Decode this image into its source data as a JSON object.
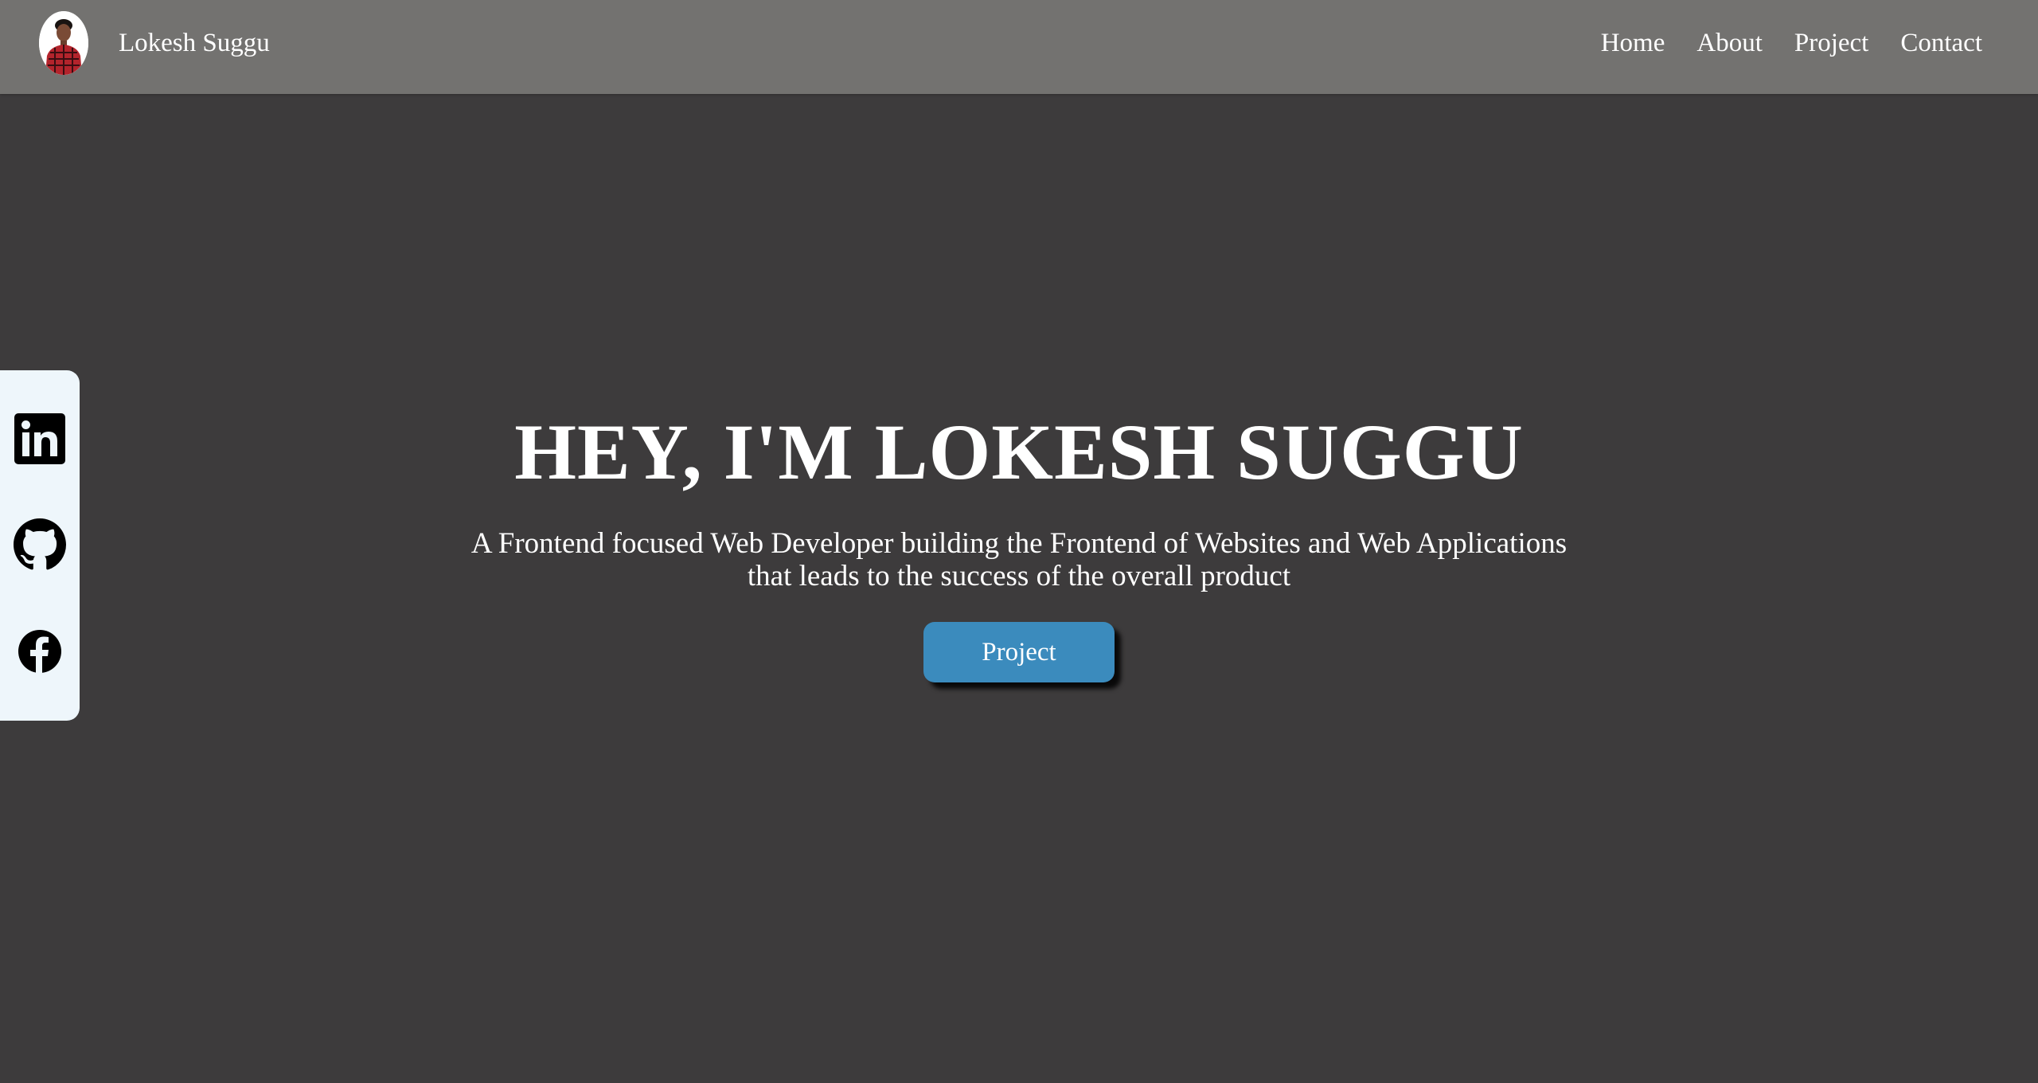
{
  "header": {
    "brand_name": "Lokesh Suggu",
    "avatar_icon": "profile-photo",
    "nav": [
      {
        "label": "Home"
      },
      {
        "label": "About"
      },
      {
        "label": "Project"
      },
      {
        "label": "Contact"
      }
    ]
  },
  "social": [
    {
      "icon": "linkedin-icon"
    },
    {
      "icon": "github-icon"
    },
    {
      "icon": "facebook-icon"
    }
  ],
  "hero": {
    "title": "HEY, I'M LOKESH SUGGU",
    "subtitle": "A Frontend focused Web Developer building the Frontend of Websites and Web Applications that leads to the success of the overall product",
    "cta_label": "Project"
  },
  "colors": {
    "header_bg": "#737270",
    "page_bg": "#3d3b3c",
    "sidebar_bg": "#eef6fb",
    "cta_bg": "#3b8bbd"
  }
}
